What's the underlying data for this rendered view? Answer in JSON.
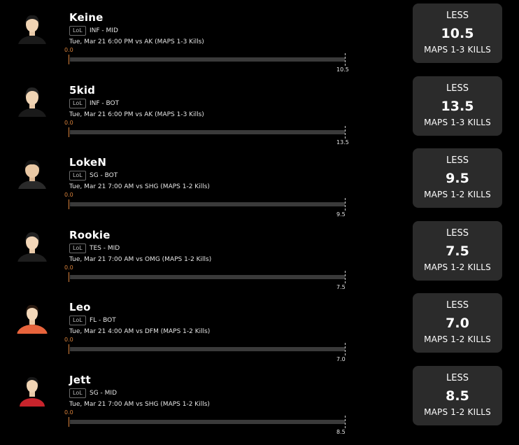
{
  "players": [
    {
      "name": "Keine",
      "game_tag": "LoL",
      "team_position": "INF - MID",
      "game_info": "Tue, Mar 21 6:00 PM  vs AK (MAPS 1-3 Kills)",
      "min_label": "0.0",
      "max_label": "10.5",
      "pick": {
        "direction": "LESS",
        "line": "10.5",
        "stat": "MAPS 1-3 KILLS"
      },
      "jersey_color": "#1a1a1a"
    },
    {
      "name": "5kid",
      "game_tag": "LoL",
      "team_position": "INF - BOT",
      "game_info": "Tue, Mar 21 6:00 PM  vs AK (MAPS 1-3 Kills)",
      "min_label": "0.0",
      "max_label": "13.5",
      "pick": {
        "direction": "LESS",
        "line": "13.5",
        "stat": "MAPS 1-3 KILLS"
      },
      "jersey_color": "#1a1a1a"
    },
    {
      "name": "LokeN",
      "game_tag": "LoL",
      "team_position": "SG - BOT",
      "game_info": "Tue, Mar 21 7:00 AM  vs SHG (MAPS 1-2 Kills)",
      "min_label": "0.0",
      "max_label": "9.5",
      "pick": {
        "direction": "LESS",
        "line": "9.5",
        "stat": "MAPS 1-2 KILLS"
      },
      "jersey_color": "#2a2a2a"
    },
    {
      "name": "Rookie",
      "game_tag": "LoL",
      "team_position": "TES - MID",
      "game_info": "Tue, Mar 21 7:00 AM  vs OMG (MAPS 1-2 Kills)",
      "min_label": "0.0",
      "max_label": "7.5",
      "pick": {
        "direction": "LESS",
        "line": "7.5",
        "stat": "MAPS 1-2 KILLS"
      },
      "jersey_color": "#1e1e1e"
    },
    {
      "name": "Leo",
      "game_tag": "LoL",
      "team_position": "FL - BOT",
      "game_info": "Tue, Mar 21 4:00 AM  vs DFM (MAPS 1-2 Kills)",
      "min_label": "0.0",
      "max_label": "7.0",
      "pick": {
        "direction": "LESS",
        "line": "7.0",
        "stat": "MAPS 1-2 KILLS"
      },
      "jersey_color": "#e8643c"
    },
    {
      "name": "Jett",
      "game_tag": "LoL",
      "team_position": "SG - MID",
      "game_info": "Tue, Mar 21 7:00 AM  vs SHG (MAPS 1-2 Kills)",
      "min_label": "0.0",
      "max_label": "8.5",
      "pick": {
        "direction": "LESS",
        "line": "8.5",
        "stat": "MAPS 1-2 KILLS"
      },
      "jersey_color": "#c8242c"
    }
  ],
  "colors": {
    "background": "#000000",
    "card": "#2b2b2b",
    "track": "#3a3a3a",
    "min_accent": "#d9823b"
  }
}
